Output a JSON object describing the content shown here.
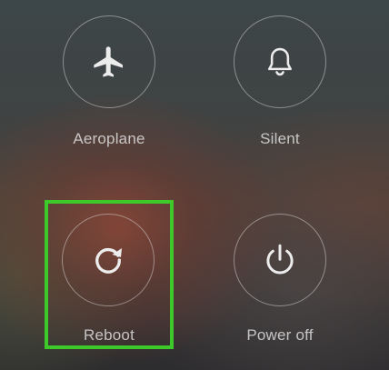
{
  "power_menu": {
    "aeroplane": {
      "label": "Aeroplane",
      "icon": "airplane-icon"
    },
    "silent": {
      "label": "Silent",
      "icon": "bell-icon"
    },
    "reboot": {
      "label": "Reboot",
      "icon": "refresh-icon"
    },
    "power_off": {
      "label": "Power off",
      "icon": "power-icon"
    }
  },
  "highlight_color": "#3ec92b"
}
